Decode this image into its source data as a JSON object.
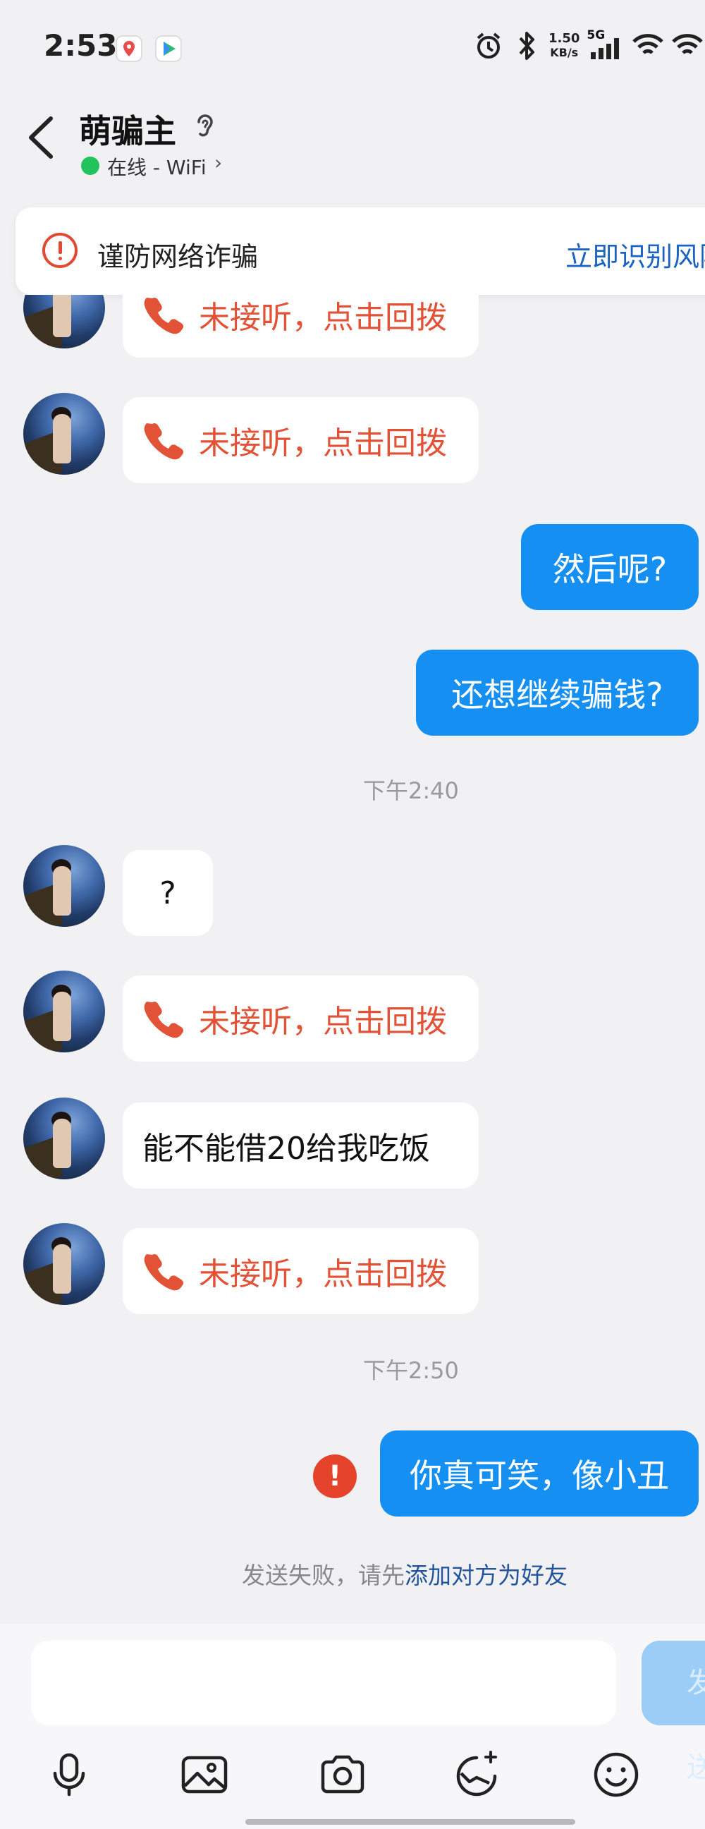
{
  "status_bar": {
    "time": "2:53",
    "net_speed_value": "1.50",
    "net_speed_unit": "KB/s",
    "signal_label": "5G"
  },
  "header": {
    "contact_name": "萌骗主",
    "online_status": "在线 - WiFi",
    "chevron": "›"
  },
  "fraud_banner": {
    "text": "谨防网络诈骗",
    "action": "立即识别风险"
  },
  "messages": {
    "m1_text": "未接听，点击回拨",
    "m2_text": "未接听，点击回拨",
    "m3_text": "然后呢?",
    "m4_text": "还想继续骗钱?",
    "time1": "下午2:40",
    "m5_text": "?",
    "m6_text": "未接听，点击回拨",
    "m7_text": "能不能借20给我吃饭",
    "m8_text": "未接听，点击回拨",
    "time2": "下午2:50",
    "m9_text": "你真可笑，像小丑"
  },
  "send_failed": {
    "badge": "!",
    "prefix": "发送失败，请先",
    "link": "添加对方为好友"
  },
  "input": {
    "value": "",
    "send_label": "发送"
  },
  "colors": {
    "outgoing_bubble": "#1590f2",
    "missed_call": "#e25237",
    "link": "#1a63c2",
    "error_badge": "#e5432b"
  },
  "icons": [
    "back-icon",
    "ear-icon",
    "warning-icon",
    "phone-icon",
    "microphone-icon",
    "image-icon",
    "camera-icon",
    "sticker-icon",
    "emoji-icon"
  ]
}
